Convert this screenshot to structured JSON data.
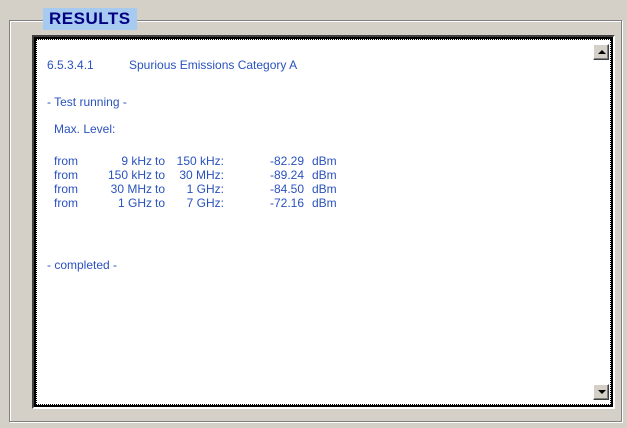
{
  "group": {
    "title": "RESULTS"
  },
  "results": {
    "test_number": "6.5.3.4.1",
    "test_name": "Spurious Emissions Category A",
    "status_running": "- Test running -",
    "max_level_label": "Max. Level:",
    "rows": [
      {
        "from": "from",
        "start": "9 kHz",
        "to": "to",
        "end": "150 kHz:",
        "value": "-82.29",
        "unit": "dBm"
      },
      {
        "from": "from",
        "start": "150 kHz",
        "to": "to",
        "end": "30 MHz:",
        "value": "-89.24",
        "unit": "dBm"
      },
      {
        "from": "from",
        "start": "30 MHz",
        "to": "to",
        "end": "1 GHz:",
        "value": "-84.50",
        "unit": "dBm"
      },
      {
        "from": "from",
        "start": "1 GHz",
        "to": "to",
        "end": "7 GHz:",
        "value": "-72.16",
        "unit": "dBm"
      }
    ],
    "status_completed": "- completed -"
  },
  "icons": {
    "scroll_up": "arrow-up",
    "scroll_down": "arrow-down"
  }
}
